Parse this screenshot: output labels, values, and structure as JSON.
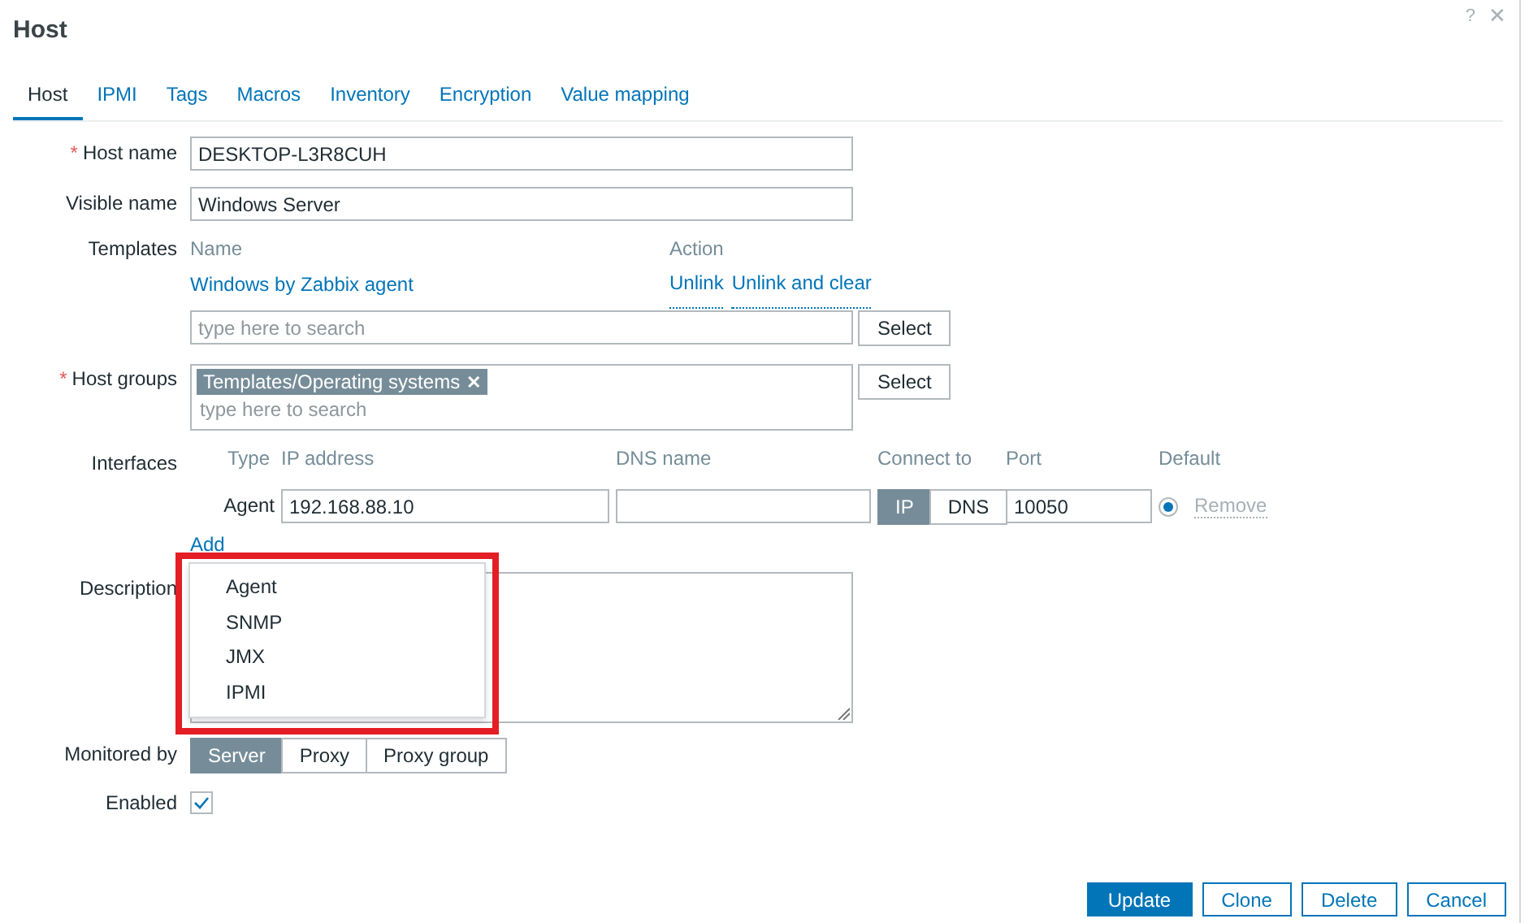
{
  "window": {
    "title": "Host",
    "help": "?",
    "close": "✕"
  },
  "tabs": [
    {
      "label": "Host",
      "selected": true
    },
    {
      "label": "IPMI",
      "selected": false
    },
    {
      "label": "Tags",
      "selected": false
    },
    {
      "label": "Macros",
      "selected": false
    },
    {
      "label": "Inventory",
      "selected": false
    },
    {
      "label": "Encryption",
      "selected": false
    },
    {
      "label": "Value mapping",
      "selected": false
    }
  ],
  "form": {
    "host_name": {
      "label": "Host name",
      "required_mark": "*",
      "value": "DESKTOP-L3R8CUH"
    },
    "visible_name": {
      "label": "Visible name",
      "value": "Windows Server"
    },
    "templates": {
      "label": "Templates",
      "columns": [
        "Name",
        "Action"
      ],
      "rows": [
        {
          "name": "Windows by Zabbix agent",
          "actions": [
            "Unlink",
            "Unlink and clear"
          ]
        }
      ],
      "placeholder": "type here to search",
      "button": "Select"
    },
    "host_groups": {
      "label": "Host groups",
      "required_mark": "*",
      "tags": [
        {
          "label": "Templates/Operating systems",
          "remove": "✕"
        }
      ],
      "placeholder": "type here to search",
      "button": "Select"
    },
    "interfaces": {
      "label": "Interfaces",
      "columns": [
        "Type",
        "IP address",
        "DNS name",
        "Connect to",
        "Port",
        "Default"
      ],
      "rows": [
        {
          "type": "Agent",
          "ip": "192.168.88.10",
          "dns": "",
          "connect": [
            {
              "label": "IP",
              "selected": true
            },
            {
              "label": "DNS",
              "selected": false
            }
          ],
          "port": "10050",
          "default": true,
          "remove": "Remove"
        }
      ],
      "add": "Add",
      "menu": [
        {
          "label": "Agent"
        },
        {
          "label": "SNMP"
        },
        {
          "label": "JMX"
        },
        {
          "label": "IPMI"
        }
      ]
    },
    "description": {
      "label": "Description"
    },
    "monitored_by": {
      "label": "Monitored by",
      "options": [
        {
          "label": "Server",
          "selected": true
        },
        {
          "label": "Proxy",
          "selected": false
        },
        {
          "label": "Proxy group",
          "selected": false
        }
      ]
    },
    "enabled": {
      "label": "Enabled",
      "checked": true
    }
  },
  "buttons": [
    {
      "label": "Update",
      "kind": "primary"
    },
    {
      "label": "Clone",
      "kind": "secondary"
    },
    {
      "label": "Delete",
      "kind": "secondary"
    },
    {
      "label": "Cancel",
      "kind": "secondary"
    }
  ]
}
